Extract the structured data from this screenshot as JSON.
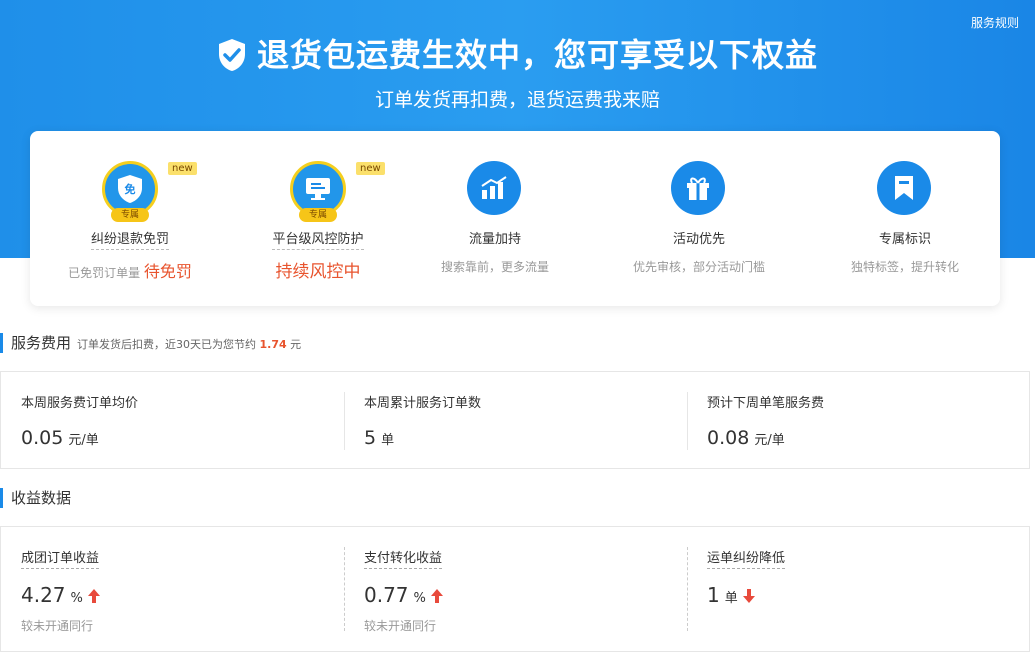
{
  "header": {
    "title": "退货包运费生效中，您可享受以下权益",
    "subtitle": "订单发货再扣费，退货运费我来赔",
    "rules_link": "服务规则"
  },
  "benefits": [
    {
      "icon": "shield-free-icon",
      "badge": "专属",
      "new": "new",
      "name": "纠纷退款免罚",
      "desc": "已免罚订单量",
      "highlight": "待免罚"
    },
    {
      "icon": "monitor-icon",
      "badge": "专属",
      "new": "new",
      "name": "平台级风控防护",
      "highlight": "持续风控中"
    },
    {
      "icon": "bar-chart-icon",
      "name": "流量加持",
      "desc": "搜索靠前，更多流量"
    },
    {
      "icon": "gift-icon",
      "name": "活动优先",
      "desc": "优先审核，部分活动门槛"
    },
    {
      "icon": "bookmark-icon",
      "name": "专属标识",
      "desc": "独特标签，提升转化"
    }
  ],
  "service_fee": {
    "title": "服务费用",
    "note_prefix": "订单发货后扣费，近30天已为您节约",
    "saved_amount": "1.74",
    "note_suffix": "元",
    "stats": [
      {
        "label": "本周服务费订单均价",
        "value": "0.05",
        "unit": "元/单"
      },
      {
        "label": "本周累计服务订单数",
        "value": "5",
        "unit": "单"
      },
      {
        "label": "预计下周单笔服务费",
        "value": "0.08",
        "unit": "元/单"
      }
    ]
  },
  "revenue": {
    "title": "收益数据",
    "stats": [
      {
        "label": "成团订单收益",
        "value": "4.27",
        "unit": "%",
        "trend": "up",
        "note": "较未开通同行"
      },
      {
        "label": "支付转化收益",
        "value": "0.77",
        "unit": "%",
        "trend": "up",
        "note": "较未开通同行"
      },
      {
        "label": "运单纠纷降低",
        "value": "1",
        "unit": "单",
        "trend": "down"
      }
    ]
  },
  "colors": {
    "brand_blue": "#1a8ae8",
    "highlight": "#e8542e",
    "gold": "#f5cf1e"
  }
}
